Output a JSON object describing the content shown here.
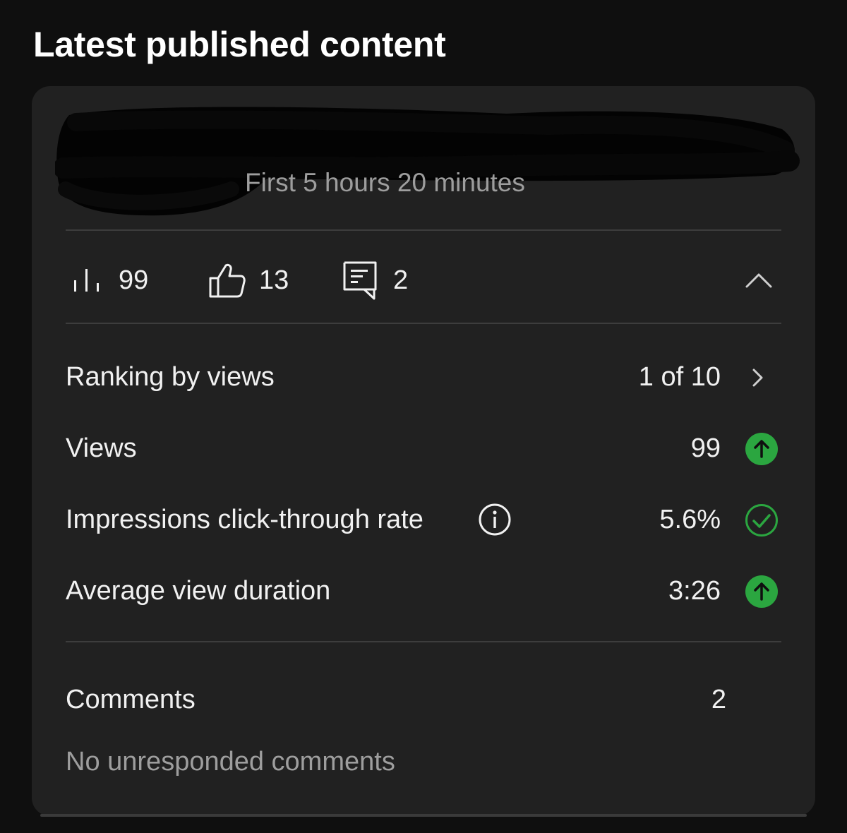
{
  "header": {
    "title": "Latest published content"
  },
  "video": {
    "period": "First 5 hours 20 minutes"
  },
  "stats": {
    "views": "99",
    "likes": "13",
    "comments": "2"
  },
  "metrics": [
    {
      "label": "Ranking by views",
      "value": "1 of 10",
      "indicator": "chevron-right-icon"
    },
    {
      "label": "Views",
      "value": "99",
      "indicator": "arrow-up-circle-icon"
    },
    {
      "label": "Impressions click-through rate",
      "value": "5.6%",
      "indicator": "check-circle-icon"
    },
    {
      "label": "Average view duration",
      "value": "3:26",
      "indicator": "arrow-up-circle-icon"
    }
  ],
  "comments_section": {
    "label": "Comments",
    "count": "2",
    "status": "No unresponded comments"
  },
  "colors": {
    "background": "#0f0f0f",
    "card": "#212121",
    "positive": "#2ba640",
    "muted_text": "#9e9e9e"
  }
}
